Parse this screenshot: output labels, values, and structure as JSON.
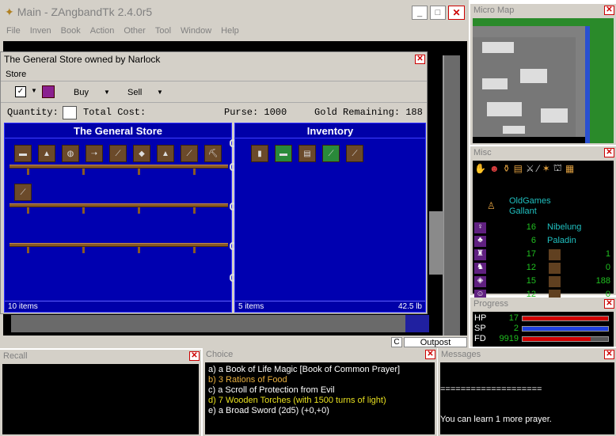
{
  "main": {
    "title": "Main - ZAngbandTk 2.4.0r5",
    "menu": [
      "File",
      "Inven",
      "Book",
      "Action",
      "Other",
      "Tool",
      "Window",
      "Help"
    ],
    "status_letter": "C",
    "location": "Outpost"
  },
  "store": {
    "title": "The General Store owned by Narlock",
    "menu": "Store",
    "buy_label": "Buy",
    "sell_label": "Sell",
    "quantity_label": "Quantity:",
    "total_cost_label": "Total Cost:",
    "purse": "Purse: 1000",
    "gold_remaining": "Gold Remaining: 188",
    "store_pane_title": "The General Store",
    "inventory_pane_title": "Inventory",
    "store_count": "10 items",
    "inventory_count": "5 items",
    "inventory_weight": "42.5 lb",
    "store_items": [
      "food",
      "torch",
      "flask",
      "arrow",
      "spike",
      "oil",
      "cloak",
      "shovel",
      "pick",
      "shot"
    ],
    "inventory_items": [
      "book",
      "food",
      "scroll",
      "torch",
      "sword"
    ]
  },
  "micro_map": {
    "title": "Micro Map"
  },
  "misc": {
    "title": "Misc",
    "name": "OldGames",
    "title_text": "Gallant",
    "rows": [
      {
        "left": "16",
        "right_label": "Nibelung",
        "right": ""
      },
      {
        "left": "6",
        "right_label": "Paladin",
        "right": ""
      },
      {
        "left": "17",
        "right_label": "",
        "right": "1"
      },
      {
        "left": "12",
        "right_label": "",
        "right": "0"
      },
      {
        "left": "15",
        "right_label": "",
        "right": "188"
      },
      {
        "left": "12",
        "right_label": "",
        "right": "0"
      }
    ]
  },
  "progress": {
    "title": "Progress",
    "hp_label": "HP",
    "hp": "17",
    "hp_fraction": 1.0,
    "sp_label": "SP",
    "sp": "2",
    "sp_fraction": 1.0,
    "fd_label": "FD",
    "fd": "9919",
    "fd_fraction": 0.8,
    "colors": {
      "hp": "#d00000",
      "sp": "#2040e0",
      "fd": "#d00000"
    }
  },
  "recall": {
    "title": "Recall"
  },
  "choice": {
    "title": "Choice",
    "items": [
      {
        "text": "a) a Book of Life Magic [Book of Common Prayer]",
        "color": "#ffffff"
      },
      {
        "text": "b) 3 Rations of Food",
        "color": "#e8b040"
      },
      {
        "text": "c) a Scroll of Protection from Evil",
        "color": "#ffffff"
      },
      {
        "text": "d) 7 Wooden Torches (with 1500 turns of light)",
        "color": "#e8e020"
      },
      {
        "text": "e) a Broad Sword (2d5) (+0,+0)",
        "color": "#ffffff"
      }
    ]
  },
  "messages": {
    "title": "Messages",
    "lines": [
      "====================",
      "You can learn 1 more prayer."
    ]
  }
}
